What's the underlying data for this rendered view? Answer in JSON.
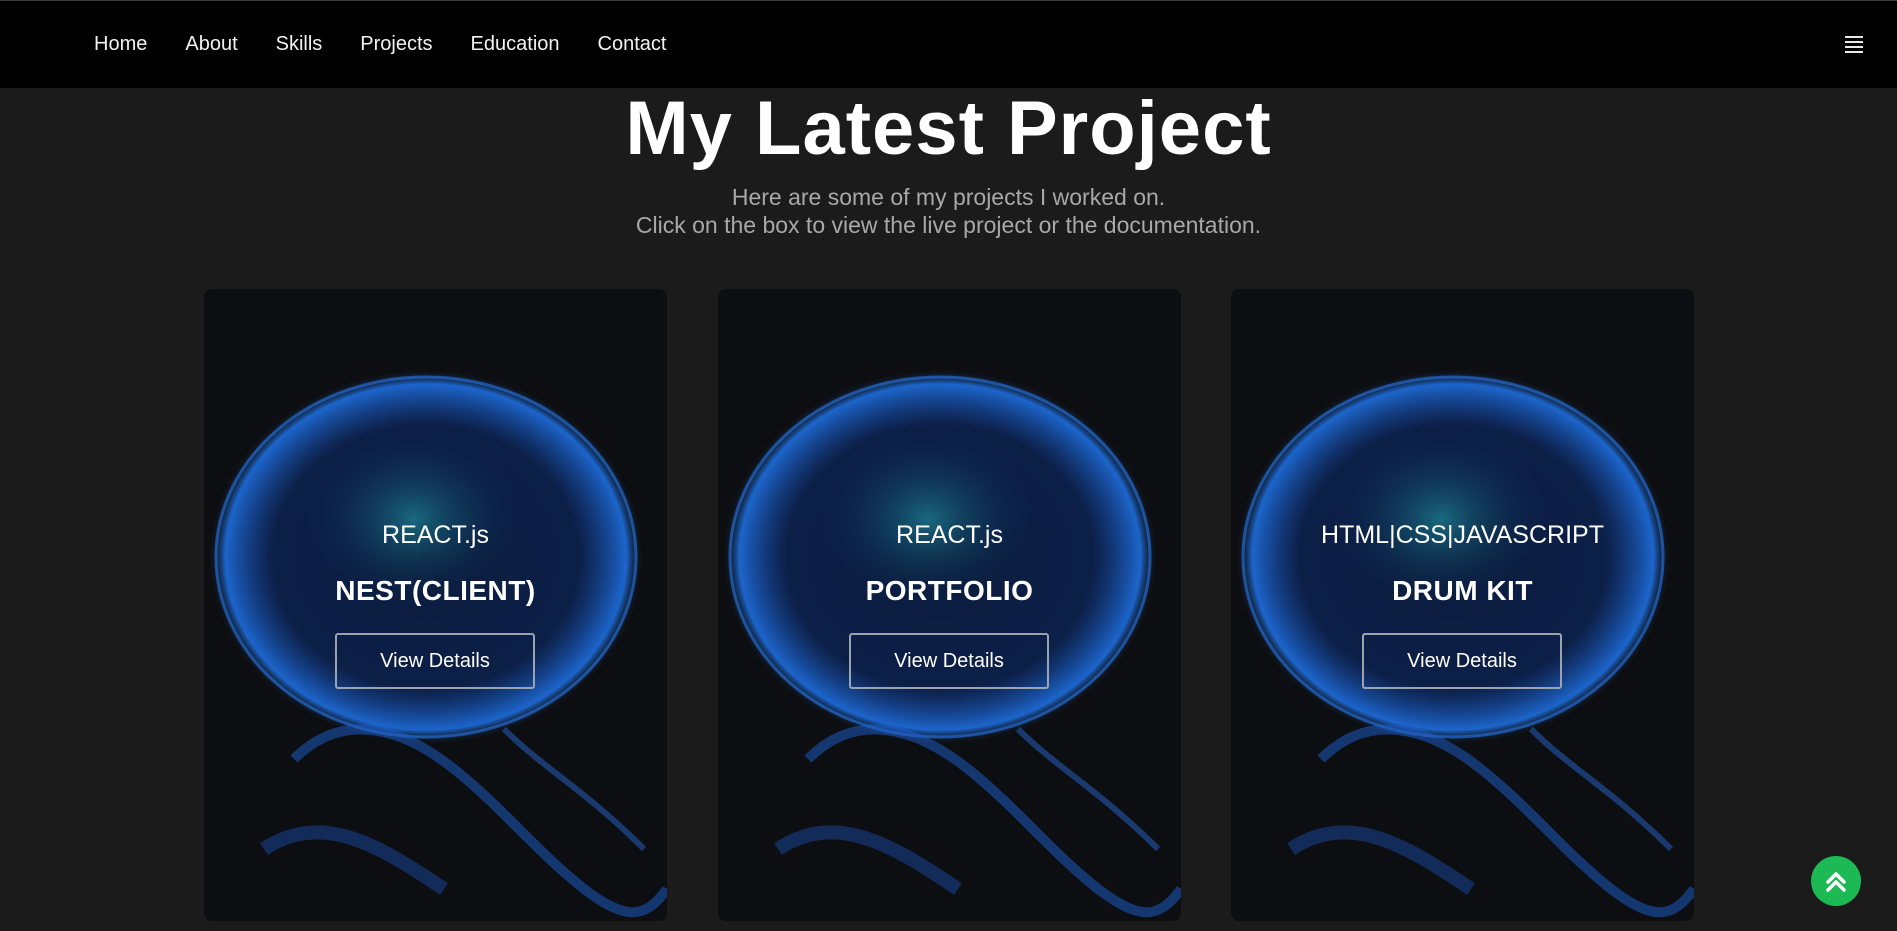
{
  "nav": {
    "items": [
      "Home",
      "About",
      "Skills",
      "Projects",
      "Education",
      "Contact"
    ],
    "menu_icon": "hamburger-menu-icon"
  },
  "header": {
    "title": "My Latest Project",
    "subtitle_line1": "Here are some of my projects I worked on.",
    "subtitle_line2": "Click on the box to view the live project or the documentation."
  },
  "projects": [
    {
      "tech": "REACT.js",
      "name": "NEST(CLIENT)",
      "button": "View Details"
    },
    {
      "tech": "REACT.js",
      "name": "PORTFOLIO",
      "button": "View Details"
    },
    {
      "tech": "HTML|CSS|JAVASCRIPT",
      "name": "DRUM KIT",
      "button": "View Details"
    }
  ],
  "scroll_top": {
    "icon": "double-chevron-up-icon",
    "color": "#1db954"
  },
  "colors": {
    "background": "#1b1b1b",
    "navbar": "#000000",
    "card": "#0d0e11",
    "jellyfish_glow": "#1e6fe0"
  }
}
